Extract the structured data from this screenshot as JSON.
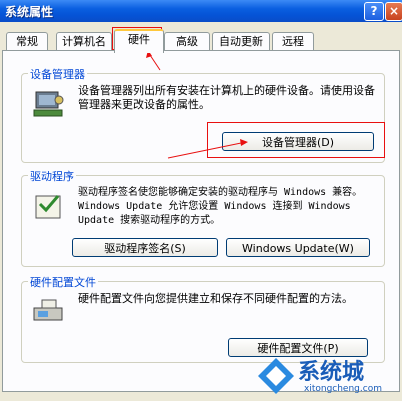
{
  "window": {
    "title": "系统属性",
    "help_icon": "?",
    "close_icon": "×"
  },
  "tabs": [
    {
      "label": "常规"
    },
    {
      "label": "计算机名"
    },
    {
      "label": "硬件",
      "active": true
    },
    {
      "label": "高级"
    },
    {
      "label": "自动更新"
    },
    {
      "label": "远程"
    }
  ],
  "device_manager": {
    "legend": "设备管理器",
    "description": "设备管理器列出所有安装在计算机上的硬件设备。请使用设备管理器来更改设备的属性。",
    "button_label": "设备管理器(D)"
  },
  "drivers": {
    "legend": "驱动程序",
    "description": "驱动程序签名使您能够确定安装的驱动程序与 Windows 兼容。Windows Update 允许您设置 Windows 连接到 Windows Update 搜索驱动程序的方式。",
    "signing_button_label": "驱动程序签名(S)",
    "update_button_label": "Windows Update(W)"
  },
  "hardware_profiles": {
    "legend": "硬件配置文件",
    "description": "硬件配置文件向您提供建立和保存不同硬件配置的方法。",
    "button_label": "硬件配置文件(P)"
  },
  "watermark": {
    "title": "系统城",
    "url": "xitongcheng.com"
  },
  "colors": {
    "titlebar": "#0553d6",
    "legend": "#0046d5",
    "annotation": "#e81010",
    "tab_highlight": "#ffc83c"
  }
}
